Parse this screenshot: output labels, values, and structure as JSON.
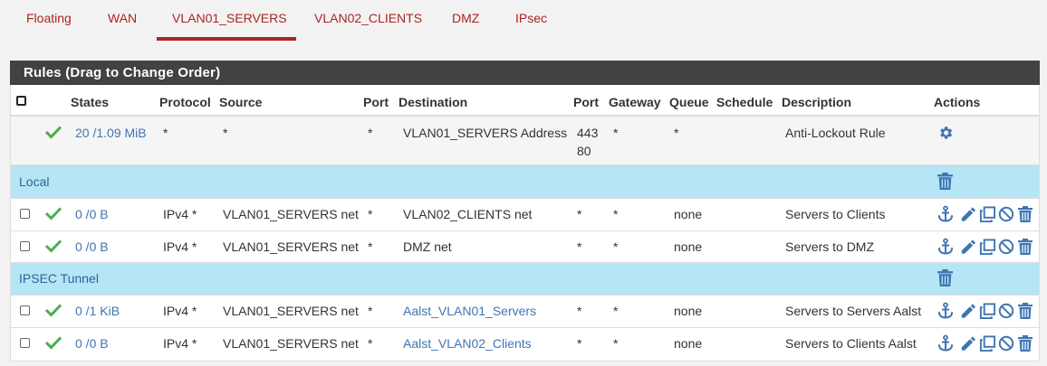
{
  "tabs": [
    {
      "label": "Floating"
    },
    {
      "label": "WAN"
    },
    {
      "label": "VLAN01_SERVERS"
    },
    {
      "label": "VLAN02_CLIENTS"
    },
    {
      "label": "DMZ"
    },
    {
      "label": "IPsec"
    }
  ],
  "active_tab": "VLAN01_SERVERS",
  "panel": {
    "title": "Rules (Drag to Change Order)"
  },
  "columns": {
    "states": "States",
    "protocol": "Protocol",
    "source": "Source",
    "port": "Port",
    "destination": "Destination",
    "dst_port": "Port",
    "gateway": "Gateway",
    "queue": "Queue",
    "schedule": "Schedule",
    "description": "Description",
    "actions": "Actions"
  },
  "colors": {
    "accent": "#ac2521",
    "link": "#4075b3",
    "separator_bg": "#b6e5f5",
    "check_green": "#4cae4c",
    "heading_bg": "#424242"
  },
  "lockout_rule": {
    "states": "20 /1.09 MiB",
    "protocol": "*",
    "source": "*",
    "port": "*",
    "destination": "VLAN01_SERVERS Address",
    "dst_port_1": "443",
    "dst_port_2": "80",
    "gateway": "*",
    "queue": "*",
    "description": "Anti-Lockout Rule"
  },
  "separators": [
    {
      "label": "Local"
    },
    {
      "label": "IPSEC Tunnel"
    }
  ],
  "rules": [
    {
      "states": "0 /0 B",
      "protocol": "IPv4 *",
      "source": "VLAN01_SERVERS net",
      "port": "*",
      "destination": "VLAN02_CLIENTS net",
      "dst_port": "*",
      "gateway": "*",
      "queue": "none",
      "description": "Servers to Clients"
    },
    {
      "states": "0 /0 B",
      "protocol": "IPv4 *",
      "source": "VLAN01_SERVERS net",
      "port": "*",
      "destination": "DMZ net",
      "dst_port": "*",
      "gateway": "*",
      "queue": "none",
      "description": "Servers to DMZ"
    },
    {
      "states": "0 /1 KiB",
      "protocol": "IPv4 *",
      "source": "VLAN01_SERVERS net",
      "port": "*",
      "destination": "Aalst_VLAN01_Servers",
      "dst_port": "*",
      "gateway": "*",
      "queue": "none",
      "description": "Servers to Servers Aalst"
    },
    {
      "states": "0 /0 B",
      "protocol": "IPv4 *",
      "source": "VLAN01_SERVERS net",
      "port": "*",
      "destination": "Aalst_VLAN02_Clients",
      "dst_port": "*",
      "gateway": "*",
      "queue": "none",
      "description": "Servers to Clients Aalst"
    }
  ]
}
